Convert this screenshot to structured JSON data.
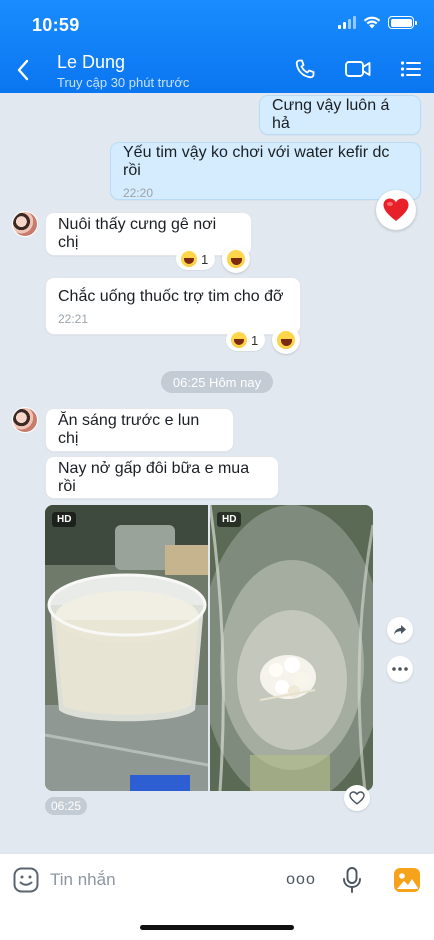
{
  "status_bar": {
    "time": "10:59"
  },
  "header": {
    "name": "Le Dung",
    "status": "Truy cập 30 phút trước",
    "colors": {
      "primary": "#0a76f0"
    }
  },
  "messages": {
    "m1": {
      "text": "Cưng vậy luôn á hả"
    },
    "m2": {
      "text": "Yếu tim vậy ko chơi với water kefir dc rồi",
      "time": "22:20"
    },
    "m3": {
      "text": "Nuôi thấy cưng gê nơi chị",
      "reaction_count": "1"
    },
    "m4": {
      "text": "Chắc uống thuốc trợ tim cho đỡ",
      "time": "22:21",
      "reaction_count": "1"
    },
    "date_separator": "06:25 Hôm nay",
    "m5": {
      "text": "Ăn sáng trước e lun chị"
    },
    "m6": {
      "text": "Nay nở gấp đôi bữa e mua rồi"
    },
    "photos": {
      "badge": "HD",
      "time": "06:25"
    }
  },
  "input": {
    "placeholder": "Tin nhắn",
    "more_label": "ooo"
  },
  "icons": [
    "back-icon",
    "phone-icon",
    "video-icon",
    "list-icon",
    "heart-icon",
    "laugh-emoji-icon",
    "share-icon",
    "more-icon",
    "emoji-icon",
    "mic-icon",
    "image-icon"
  ]
}
